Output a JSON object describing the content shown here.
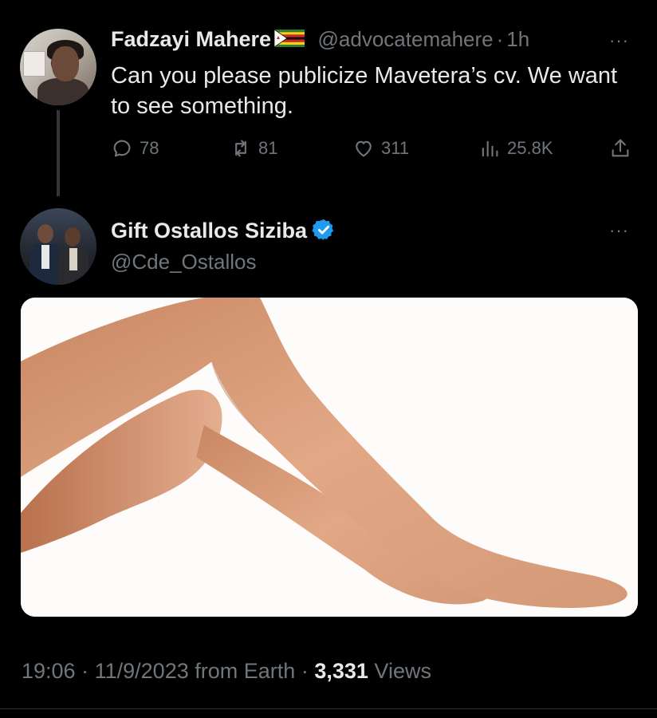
{
  "tweet1": {
    "author_name": "Fadzayi Mahere",
    "flag_icon": "zimbabwe-flag-icon",
    "handle": "@advocatemahere",
    "dot": "·",
    "time": "1h",
    "more": "···",
    "text": "Can you please publicize Mavetera’s cv. We want to see something.",
    "actions": {
      "replies": "78",
      "retweets": "81",
      "likes": "311",
      "views": "25.8K"
    }
  },
  "tweet2": {
    "author_name": "Gift Ostallos Siziba",
    "verified_icon": "verified-badge-icon",
    "handle": "@Cde_Ostallos",
    "more": "···",
    "meta": {
      "time": "19:06",
      "sep1": "·",
      "date": "11/9/2023",
      "from": "from Earth",
      "sep2": "·",
      "views_count": "3,331",
      "views_label": "Views"
    }
  },
  "colors": {
    "background": "#000000",
    "text_primary": "#e7e9ea",
    "text_secondary": "#71767b",
    "verified_blue": "#1d9bf0"
  }
}
